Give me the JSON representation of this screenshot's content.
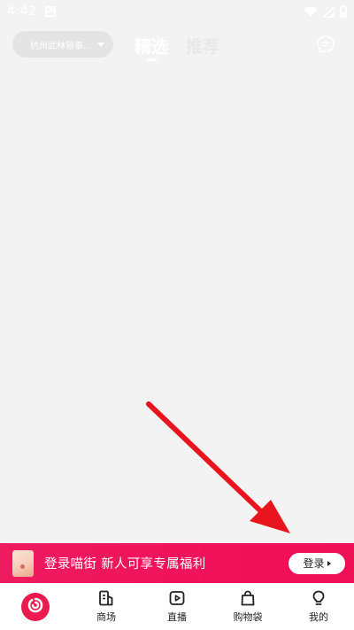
{
  "status_bar": {
    "time": "4:42",
    "icons": [
      "notification-icon",
      "wifi-icon",
      "signal-icon",
      "battery-icon"
    ]
  },
  "header": {
    "location": "杭州武林银泰...",
    "tabs": [
      {
        "label": "精选",
        "active": true
      },
      {
        "label": "推荐",
        "active": false
      }
    ],
    "message_icon": "chat-bubble-icon"
  },
  "login_banner": {
    "text": "登录喵街 新人可享专属福利",
    "button_label": "登录"
  },
  "bottom_nav": {
    "items": [
      {
        "label": "",
        "icon": "home-logo-icon"
      },
      {
        "label": "商场",
        "icon": "mall-icon"
      },
      {
        "label": "直播",
        "icon": "live-icon"
      },
      {
        "label": "购物袋",
        "icon": "shopping-bag-icon"
      },
      {
        "label": "我的",
        "icon": "profile-icon"
      }
    ]
  },
  "colors": {
    "accent": "#EF1458",
    "background": "#F3F3F3",
    "annotation_arrow": "#E8141E"
  }
}
